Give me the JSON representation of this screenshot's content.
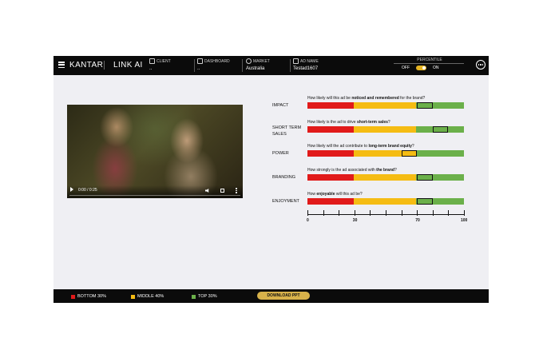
{
  "header": {
    "brand": "KANTAR",
    "product": "LINK AI",
    "fields": [
      {
        "label": "CLIENT",
        "value": "..",
        "icon": "client-icon"
      },
      {
        "label": "DASHBOARD",
        "value": "..",
        "icon": "dashboard-icon"
      },
      {
        "label": "MARKET",
        "value": "Australia",
        "icon": "globe-icon"
      },
      {
        "label": "AD NAME",
        "value": "Testad1607",
        "icon": "ad-icon"
      }
    ],
    "percentile": {
      "title": "PERCENTILE",
      "off": "OFF",
      "on": "ON",
      "state": "on"
    }
  },
  "video": {
    "time": "0:00 / 0:25",
    "progress": 0
  },
  "metrics": [
    {
      "label": "IMPACT",
      "q_pre": "How likely will this ad be ",
      "q_bold": "noticed and remembered",
      "q_post": " for the brand?",
      "range": [
        70,
        80
      ]
    },
    {
      "label": "SHORT TERM SALES",
      "q_pre": "How likely is the ad to drive ",
      "q_bold": "short-term sales",
      "q_post": "?",
      "range": [
        80,
        90
      ]
    },
    {
      "label": "POWER",
      "q_pre": "How likely will the ad contribute to ",
      "q_bold": "long-term brand equity",
      "q_post": "?",
      "range": [
        60,
        70
      ]
    },
    {
      "label": "BRANDING",
      "q_pre": "How strongly is the ad associated with ",
      "q_bold": "the brand",
      "q_post": "?",
      "range": [
        70,
        80
      ]
    },
    {
      "label": "ENJOYMENT",
      "q_pre": "How ",
      "q_bold": "enjoyable",
      "q_post": " will this ad be?",
      "range": [
        70,
        80
      ]
    }
  ],
  "scale": {
    "labels": [
      "0",
      "30",
      "70",
      "100"
    ]
  },
  "colors": {
    "bottom": "#e11a1a",
    "middle": "#f5bc13",
    "top": "#6bb04a",
    "accent": "#d8b24a"
  },
  "footer": {
    "legend": [
      {
        "label": "BOTTOM 30%",
        "color": "#e11a1a"
      },
      {
        "label": "MIDDLE 40%",
        "color": "#f5bc13"
      },
      {
        "label": "TOP 30%",
        "color": "#6bb04a"
      }
    ],
    "download_label": "DOWNLOAD PPT"
  }
}
